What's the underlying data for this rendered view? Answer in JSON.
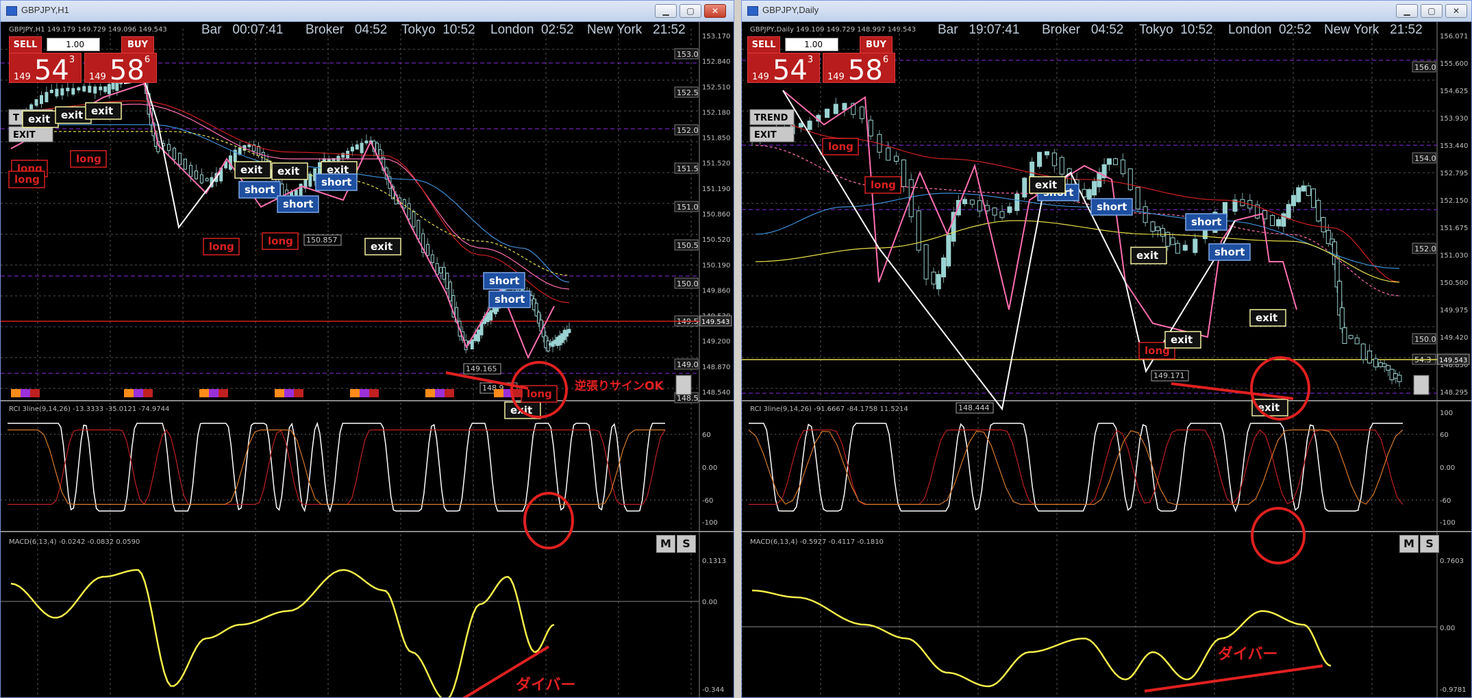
{
  "colors": {
    "bull": "#9ad3d1",
    "bear": "#7a9fa0",
    "long": "#d92020",
    "short_bg": "#1e4fa0",
    "exit_bg": "#f3f0a0",
    "ma_pink": "#ff6fb0",
    "ma_red": "#d02020",
    "ma_blue": "#3d8fd6",
    "ma_yellow": "#e8e04a",
    "annotation": "#e02020",
    "rci_white": "#ffffff",
    "rci_red": "#c02020",
    "rci_orange": "#d87a2a",
    "macd": "#f5f04a"
  },
  "hud": {
    "bar_label": "Bar",
    "broker_label": "Broker",
    "broker_time": "04:52",
    "tokyo_label": "Tokyo",
    "tokyo_time": "10:52",
    "london_label": "London",
    "london_time": "02:52",
    "newyork_label": "New York",
    "newyork_time": "21:52"
  },
  "trade_panel": {
    "sell_label": "SELL",
    "buy_label": "BUY",
    "lot": "1.00",
    "sell_prefix": "149",
    "sell_big": "54",
    "sell_sup": "3",
    "buy_prefix": "149",
    "buy_big": "58",
    "buy_sup": "6"
  },
  "windows": [
    {
      "title": "GBPJPY,H1",
      "bar_time": "00:07:41",
      "header": "GBPJPY,H1  149.179 149.729 149.096 149.543",
      "price_axis": [
        "153.170",
        "152.840",
        "152.510",
        "152.180",
        "151.850",
        "151.520",
        "151.190",
        "150.860",
        "150.520",
        "150.190",
        "149.860",
        "149.530",
        "149.200",
        "148.870",
        "148.540"
      ],
      "level_boxes": [
        "153.0",
        "152.5",
        "152.0",
        "151.5",
        "151.0",
        "150.5",
        "150.0",
        "149.5",
        "149.0",
        "148.5"
      ],
      "current_price": "149.543",
      "rci_header": "RCI 3line(9,14,26) -13.3333 -35.0121 -74.9744",
      "rci_axis": [
        "60",
        "0.00",
        "-60",
        "-100"
      ],
      "macd_header": "MACD(6,13,4) -0.0242 -0.0832 0.0590",
      "macd_axis": [
        "0.1313",
        "0.00",
        "-0.344"
      ],
      "price_labels": [
        "150.857",
        "149.165",
        "148.9"
      ],
      "signals": [
        {
          "t": "exit",
          "v": "exit"
        },
        {
          "t": "exit",
          "v": "exit"
        },
        {
          "t": "exit",
          "v": "exit"
        },
        {
          "t": "long",
          "v": "long"
        },
        {
          "t": "long",
          "v": "long"
        },
        {
          "t": "long",
          "v": "long"
        },
        {
          "t": "exit",
          "v": "exit"
        },
        {
          "t": "exit",
          "v": "exit"
        },
        {
          "t": "exit",
          "v": "exit"
        },
        {
          "t": "short",
          "v": "short"
        },
        {
          "t": "short",
          "v": "short"
        },
        {
          "t": "short",
          "v": "short"
        },
        {
          "t": "long",
          "v": "long"
        },
        {
          "t": "long",
          "v": "long"
        },
        {
          "t": "exit",
          "v": "exit"
        },
        {
          "t": "short",
          "v": "short"
        },
        {
          "t": "short",
          "v": "short"
        },
        {
          "t": "exit",
          "v": "exit"
        },
        {
          "t": "long",
          "v": "long"
        }
      ],
      "annotation_main": "逆張りサインOK",
      "annotation_macd": "ダイバー",
      "trend_labels": [
        "T",
        "EXIT"
      ]
    },
    {
      "title": "GBPJPY,Daily",
      "bar_time": "19:07:41",
      "header": "GBPJPY,Daily  149.109 149.729 148.997 149.543",
      "price_axis": [
        "156.071",
        "155.600",
        "154.625",
        "153.930",
        "153.440",
        "152.795",
        "152.150",
        "151.675",
        "151.030",
        "150.500",
        "149.975",
        "149.420",
        "148.850",
        "148.295"
      ],
      "level_boxes": [
        "156.0",
        "154.0",
        "152.0",
        "150.0",
        "54.3"
      ],
      "current_price": "149.543",
      "rci_header": "RCI 3line(9,14,26) -91.6667 -84.1758 11.5214",
      "rci_axis": [
        "100",
        "60",
        "0.00",
        "-60",
        "-100"
      ],
      "macd_header": "MACD(6,13,4) -0.5927 -0.4117 -0.1810",
      "macd_axis": [
        "0.7603",
        "0.00",
        "-0.9781"
      ],
      "price_labels": [
        "149.171",
        "148.444"
      ],
      "signals": [
        {
          "t": "long",
          "v": "long"
        },
        {
          "t": "long",
          "v": "long"
        },
        {
          "t": "short",
          "v": "short"
        },
        {
          "t": "exit",
          "v": "exit"
        },
        {
          "t": "short",
          "v": "short"
        },
        {
          "t": "exit",
          "v": "exit"
        },
        {
          "t": "long",
          "v": "long"
        },
        {
          "t": "exit",
          "v": "exit"
        },
        {
          "t": "short",
          "v": "short"
        },
        {
          "t": "short",
          "v": "short"
        },
        {
          "t": "exit",
          "v": "exit"
        },
        {
          "t": "exit",
          "v": "exit"
        }
      ],
      "annotation_macd": "ダイバー",
      "trend_labels": [
        "TREND",
        "EXIT"
      ]
    }
  ]
}
